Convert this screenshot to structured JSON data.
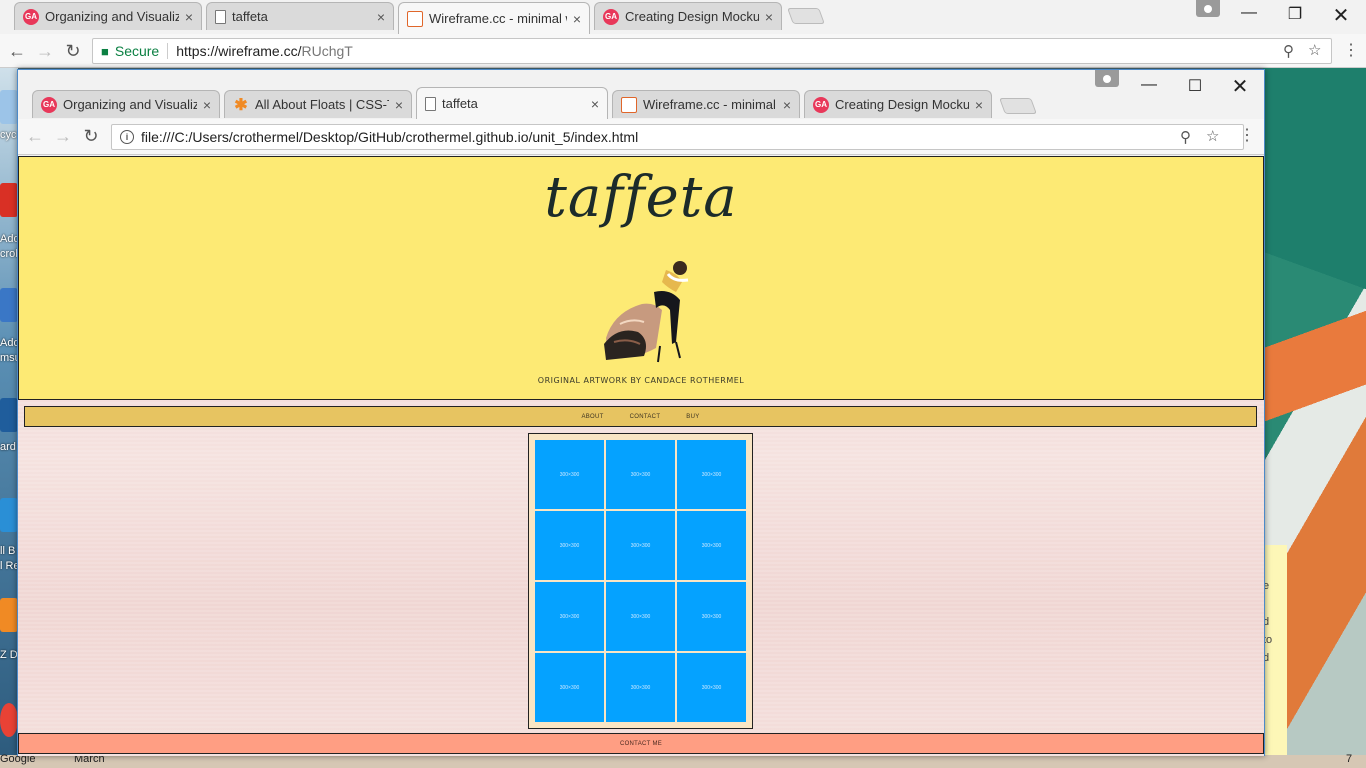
{
  "outer_browser": {
    "tabs": [
      {
        "title": "Organizing and Visualiz",
        "icon": "ga-favicon-icon",
        "active": false
      },
      {
        "title": "taffeta",
        "icon": "document-icon",
        "active": false
      },
      {
        "title": "Wireframe.cc - minimal w",
        "icon": "wireframe-favicon-icon",
        "active": true
      },
      {
        "title": "Creating Design Mockup",
        "icon": "ga-favicon-icon",
        "active": false
      }
    ],
    "secure_label": "Secure",
    "url_host": "https://wireframe.cc/",
    "url_path": "RUchgT"
  },
  "inner_browser": {
    "tabs": [
      {
        "title": "Organizing and Visualizi",
        "icon": "ga-favicon-icon",
        "active": false
      },
      {
        "title": "All About Floats | CSS-Tri",
        "icon": "css-tricks-favicon-icon",
        "active": false
      },
      {
        "title": "taffeta",
        "icon": "document-icon",
        "active": true
      },
      {
        "title": "Wireframe.cc - minimal w",
        "icon": "wireframe-favicon-icon",
        "active": false
      },
      {
        "title": "Creating Design Mockup",
        "icon": "ga-favicon-icon",
        "active": false
      }
    ],
    "url": "file:///C:/Users/crothermel/Desktop/GitHub/crothermel.github.io/unit_5/index.html"
  },
  "page": {
    "logo": "taffeta",
    "hero_caption": "ORIGINAL ARTWORK BY CANDACE ROTHERMEL",
    "nav": {
      "about": "ABOUT",
      "contact": "CONTACT",
      "buy": "BUY"
    },
    "gallery_tiles": [
      "300×300",
      "300×300",
      "300×300",
      "300×300",
      "300×300",
      "300×300",
      "300×300",
      "300×300",
      "300×300",
      "300×300",
      "300×300",
      "300×300"
    ],
    "footer_link": "CONTACT ME"
  },
  "desktop": {
    "icon_labels": [
      "cyc",
      "Ado",
      "crob",
      "Ado",
      "msu",
      "ard",
      "ll B",
      "l Re",
      "Z Di"
    ],
    "sticky_lines": [
      "e",
      "d",
      "to",
      "d"
    ],
    "taskbar_labels": [
      "Google",
      "March"
    ],
    "clock_fragment": "7"
  },
  "colors": {
    "header_yellow": "#fdea74",
    "nav_gold": "#e7c461",
    "gallery_blue": "#05a2ff",
    "footer_salmon": "#ff9e83",
    "ga_red": "#e8385a",
    "secure_green": "#0b8043"
  }
}
